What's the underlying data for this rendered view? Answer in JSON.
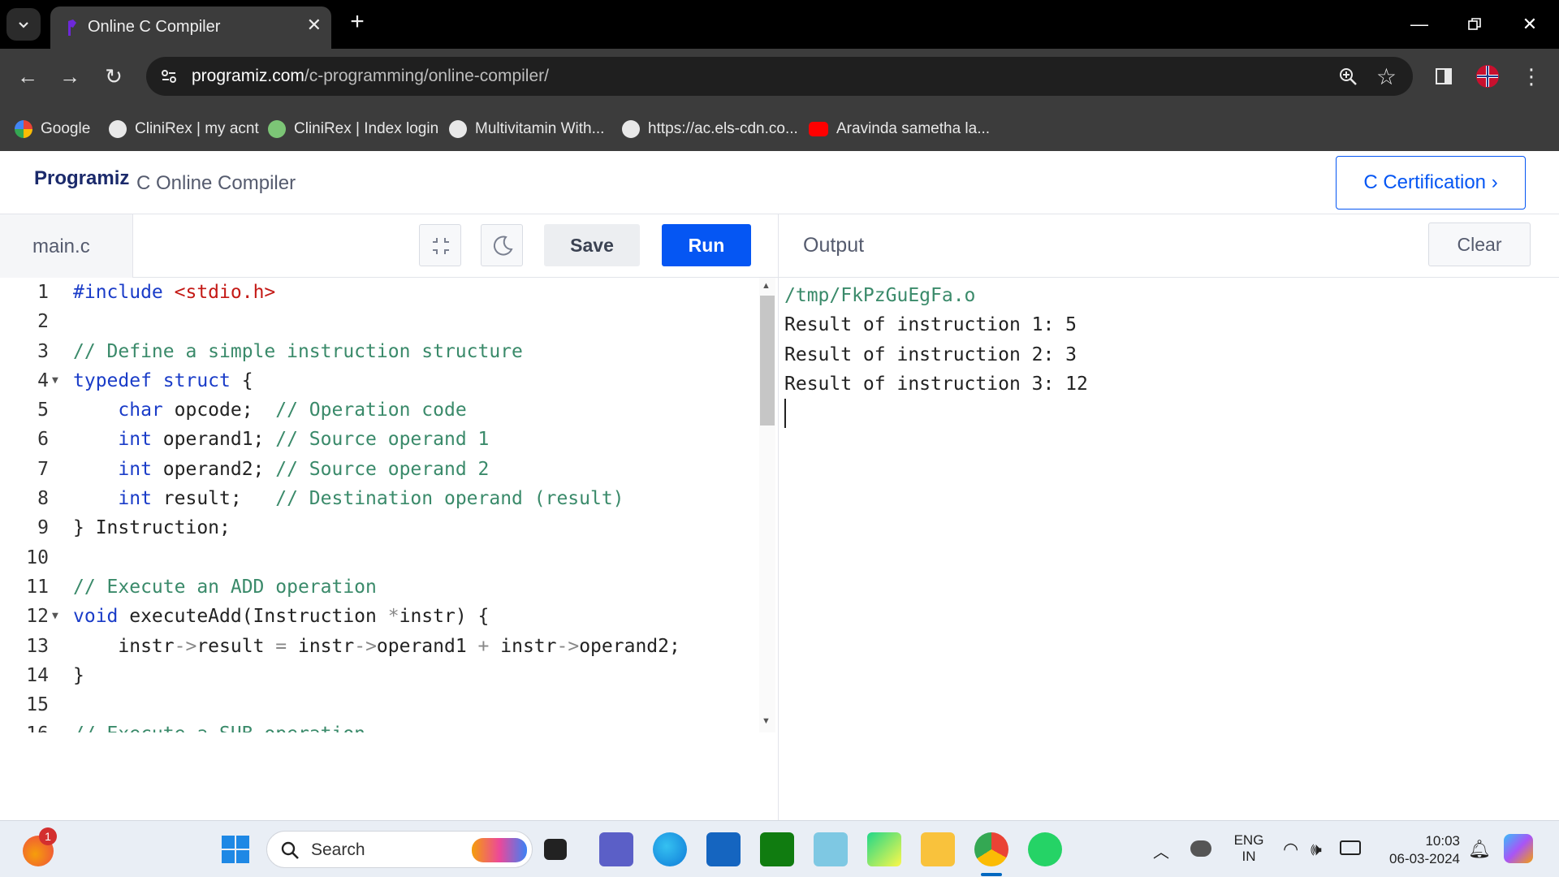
{
  "browser": {
    "tab_title": "Online C Compiler",
    "url_host": "programiz.com",
    "url_path": "/c-programming/online-compiler/",
    "bookmarks": [
      "Google",
      "CliniRex | my acnt",
      "CliniRex | Index login",
      "Multivitamin With...",
      "https://ac.els-cdn.co...",
      "Aravinda sametha la..."
    ]
  },
  "page": {
    "logo": "Programiz",
    "title": "C Online Compiler",
    "cert_button": "C Certification ›"
  },
  "editor": {
    "file_name": "main.c",
    "save_label": "Save",
    "run_label": "Run",
    "lines": [
      "#include <stdio.h>",
      "",
      "// Define a simple instruction structure",
      "typedef struct {",
      "    char opcode;  // Operation code",
      "    int operand1; // Source operand 1",
      "    int operand2; // Source operand 2",
      "    int result;   // Destination operand (result)",
      "} Instruction;",
      "",
      "// Execute an ADD operation",
      "void executeAdd(Instruction *instr) {",
      "    instr->result = instr->operand1 + instr->operand2;",
      "}",
      "",
      "// Execute a SUB operation"
    ]
  },
  "output": {
    "title": "Output",
    "clear_label": "Clear",
    "lines": [
      "/tmp/FkPzGuEgFa.o",
      "Result of instruction 1: 5",
      "Result of instruction 2: 3",
      "Result of instruction 3: 12"
    ]
  },
  "taskbar": {
    "search_placeholder": "Search",
    "notification_count": "1",
    "language": "ENG",
    "region": "IN",
    "time": "10:03",
    "date": "06-03-2024"
  },
  "colors": {
    "accent": "#0556f3",
    "keyword": "#1a3cc8",
    "string": "#c41a16",
    "comment": "#3a8a6a"
  }
}
